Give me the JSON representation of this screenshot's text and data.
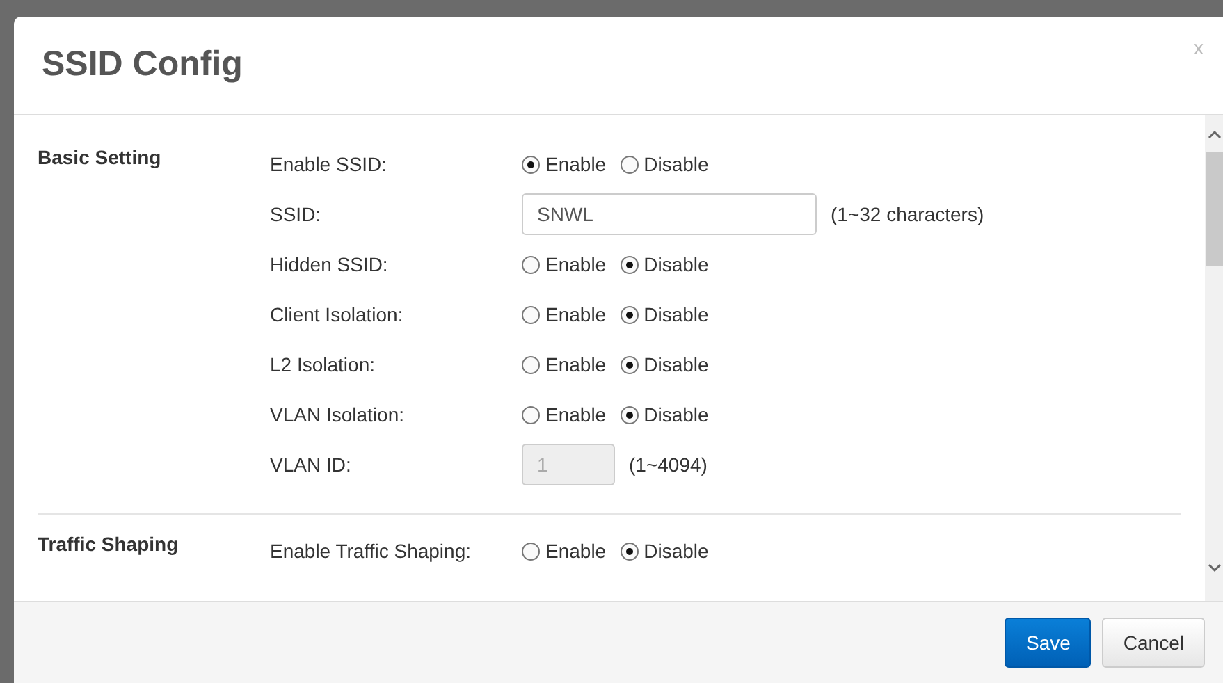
{
  "dialog": {
    "title": "SSID Config",
    "close": "x"
  },
  "sections": [
    {
      "title": "Basic Setting",
      "rows": [
        {
          "kind": "radio",
          "label": "Enable SSID:",
          "options": [
            {
              "label": "Enable",
              "selected": true
            },
            {
              "label": "Disable",
              "selected": false
            }
          ]
        },
        {
          "kind": "text",
          "label": "SSID:",
          "value": "SNWL",
          "disabled": false,
          "hint": "(1~32 characters)"
        },
        {
          "kind": "radio",
          "label": "Hidden SSID:",
          "options": [
            {
              "label": "Enable",
              "selected": false
            },
            {
              "label": "Disable",
              "selected": true
            }
          ]
        },
        {
          "kind": "radio",
          "label": "Client Isolation:",
          "options": [
            {
              "label": "Enable",
              "selected": false
            },
            {
              "label": "Disable",
              "selected": true
            }
          ]
        },
        {
          "kind": "radio",
          "label": "L2 Isolation:",
          "options": [
            {
              "label": "Enable",
              "selected": false
            },
            {
              "label": "Disable",
              "selected": true
            }
          ]
        },
        {
          "kind": "radio",
          "label": "VLAN Isolation:",
          "options": [
            {
              "label": "Enable",
              "selected": false
            },
            {
              "label": "Disable",
              "selected": true
            }
          ]
        },
        {
          "kind": "short-text",
          "label": "VLAN ID:",
          "value": "1",
          "disabled": true,
          "hint": "(1~4094)"
        }
      ]
    },
    {
      "title": "Traffic Shaping",
      "rows": [
        {
          "kind": "radio",
          "label": "Enable Traffic Shaping:",
          "options": [
            {
              "label": "Enable",
              "selected": false
            },
            {
              "label": "Disable",
              "selected": true
            }
          ]
        }
      ]
    }
  ],
  "buttons": [
    {
      "label": "Save",
      "kind": "primary"
    },
    {
      "label": "Cancel",
      "kind": "default"
    }
  ]
}
